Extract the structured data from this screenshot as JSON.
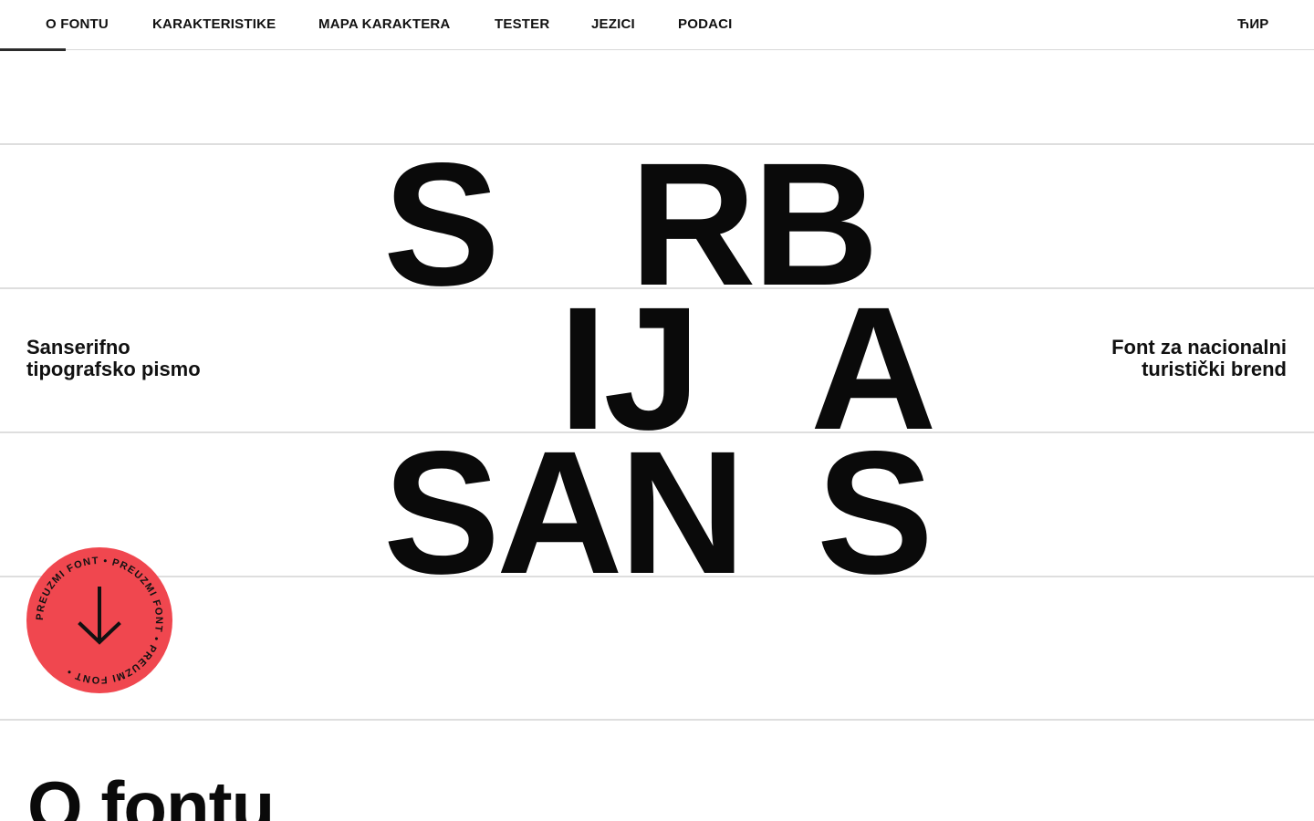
{
  "nav": {
    "items": [
      {
        "label": "O FONTU",
        "active": true
      },
      {
        "label": "KARAKTERISTIKE"
      },
      {
        "label": "MAPA KARAKTERA"
      },
      {
        "label": "TESTER"
      },
      {
        "label": "JEZICI"
      },
      {
        "label": "PODACI"
      }
    ],
    "script_toggle": "ЋИР"
  },
  "hero": {
    "row1": {
      "a": "S",
      "b": "RB"
    },
    "row2": {
      "a": "IJ",
      "b": "A"
    },
    "row3": {
      "a": "SAN",
      "b": "S"
    },
    "left_caption": {
      "line1": "Sanserifno",
      "line2": "tipografsko pismo"
    },
    "right_caption": {
      "line1": "Font za nacionalni",
      "line2": "turistički brend"
    }
  },
  "download_badge": {
    "ring_text": "PREUZMI FONT • PREUZMI FONT • PREUZMI FONT • ",
    "icon": "arrow-down-icon",
    "color": "#f0474f"
  },
  "section": {
    "title": "O fontu"
  }
}
